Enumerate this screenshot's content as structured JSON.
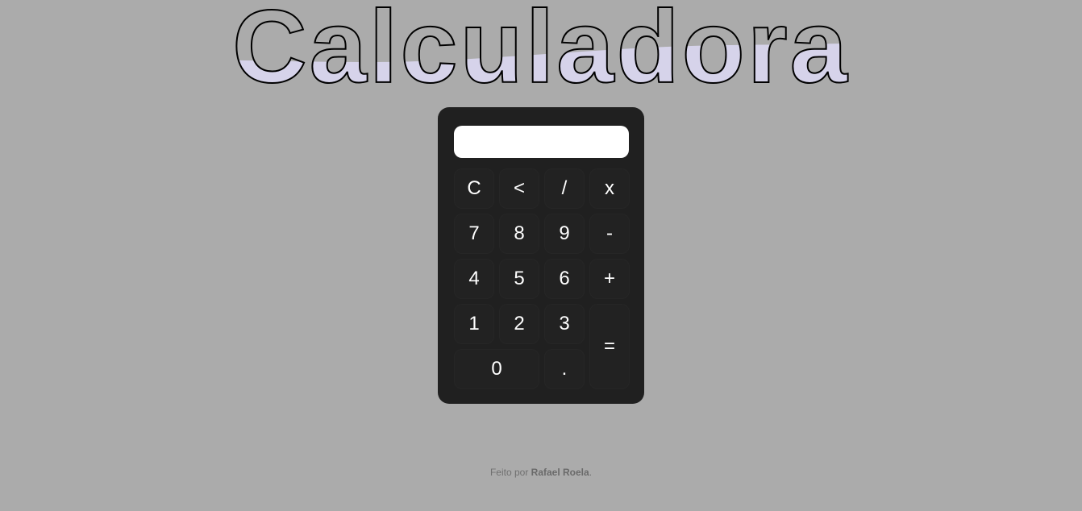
{
  "header": {
    "title": "Calculadora",
    "title_outline_color": "#000000",
    "title_fill_color": "#d6d3ea"
  },
  "calculator": {
    "display": {
      "value": "",
      "placeholder": ""
    },
    "keys": {
      "clear": "C",
      "backspace": "<",
      "divide": "/",
      "multiply": "x",
      "seven": "7",
      "eight": "8",
      "nine": "9",
      "minus": "-",
      "four": "4",
      "five": "5",
      "six": "6",
      "plus": "+",
      "one": "1",
      "two": "2",
      "three": "3",
      "equals": "=",
      "zero": "0",
      "decimal": "."
    },
    "body_color": "#202020",
    "key_color": "#222222",
    "key_text_color": "#ffffff"
  },
  "footer": {
    "prefix": "Feito por",
    "author": "Rafael Roela",
    "suffix": "."
  },
  "colors": {
    "background": "#ababab"
  }
}
